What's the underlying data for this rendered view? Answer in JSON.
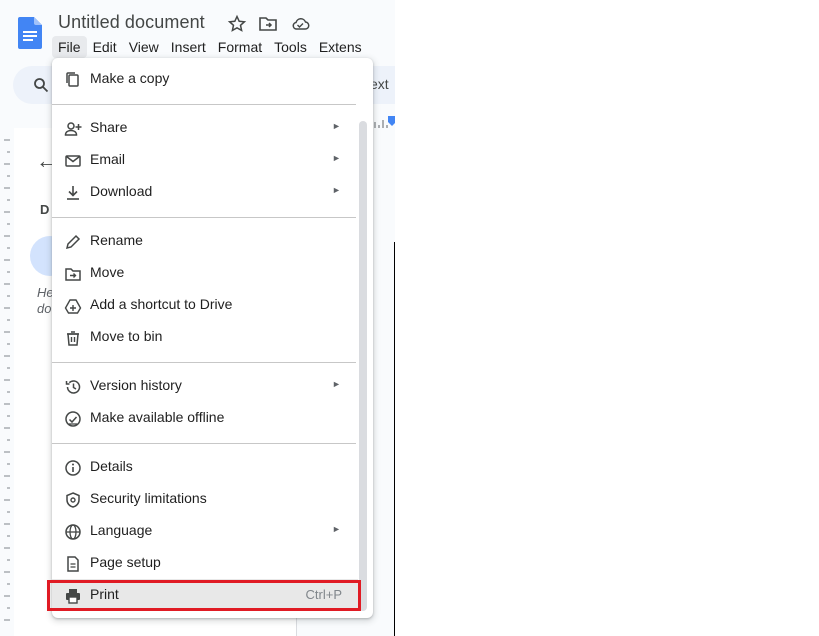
{
  "header": {
    "doc_title": "Untitled document",
    "menu": [
      "File",
      "Edit",
      "View",
      "Insert",
      "Format",
      "Tools",
      "Extens"
    ]
  },
  "toolbar": {
    "ext_text": "ext"
  },
  "outline": {
    "initial": "D",
    "hint_line1": "He",
    "hint_line2": "do"
  },
  "file_menu": {
    "items": [
      {
        "label": "Make a copy",
        "icon": "copy-icon"
      },
      {
        "label": "Share",
        "icon": "share-person-icon",
        "submenu": true
      },
      {
        "label": "Email",
        "icon": "email-icon",
        "submenu": true
      },
      {
        "label": "Download",
        "icon": "download-icon",
        "submenu": true
      },
      {
        "label": "Rename",
        "icon": "pencil-icon"
      },
      {
        "label": "Move",
        "icon": "folder-move-icon"
      },
      {
        "label": "Add a shortcut to Drive",
        "icon": "drive-shortcut-icon"
      },
      {
        "label": "Move to bin",
        "icon": "trash-icon"
      },
      {
        "label": "Version history",
        "icon": "history-icon",
        "submenu": true
      },
      {
        "label": "Make available offline",
        "icon": "offline-check-icon"
      },
      {
        "label": "Details",
        "icon": "info-icon"
      },
      {
        "label": "Security limitations",
        "icon": "shield-lock-icon"
      },
      {
        "label": "Language",
        "icon": "globe-icon",
        "submenu": true
      },
      {
        "label": "Page setup",
        "icon": "page-icon"
      },
      {
        "label": "Print",
        "icon": "printer-icon",
        "shortcut": "Ctrl+P",
        "highlighted": true
      }
    ],
    "submenu_arrow": "►"
  },
  "colors": {
    "highlight_border": "#e01b24",
    "docs_blue": "#4285f4"
  }
}
